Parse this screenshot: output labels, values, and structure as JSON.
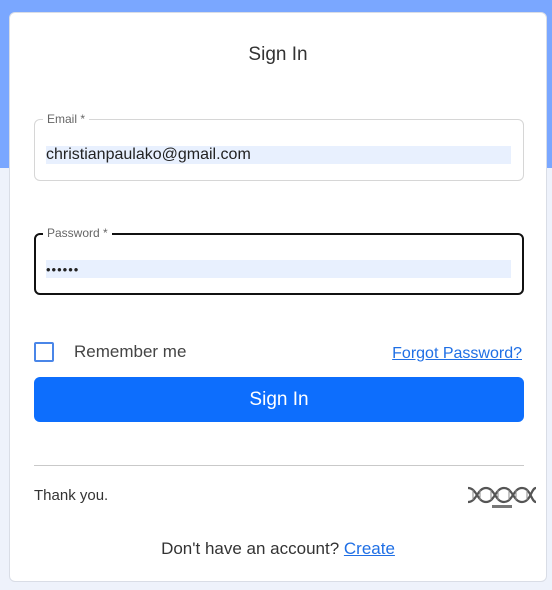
{
  "login": {
    "title": "Sign In",
    "email": {
      "label": "Email *",
      "value": "christianpaulako@gmail.com"
    },
    "password": {
      "label": "Password *",
      "value": "••••••"
    },
    "remember_label": "Remember me",
    "remember_checked": false,
    "forgot_label": "Forgot Password?",
    "submit_label": "Sign In",
    "thanks_text": "Thank you.",
    "logo_icon": "dna-helix-logo-icon",
    "signup_prompt": "Don't have an account?",
    "signup_link": "Create"
  },
  "colors": {
    "header_background": "#7aa7ff",
    "primary_button": "#0d6efd",
    "link": "#1f6fe5",
    "autofill_background": "#e8f0fe"
  }
}
